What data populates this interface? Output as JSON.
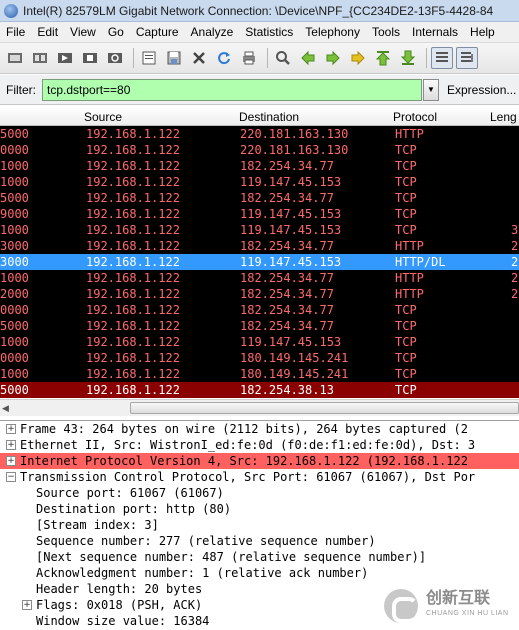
{
  "window": {
    "title": "Intel(R) 82579LM Gigabit Network Connection: \\Device\\NPF_{CC234DE2-13F5-4428-84"
  },
  "menu": [
    "File",
    "Edit",
    "View",
    "Go",
    "Capture",
    "Analyze",
    "Statistics",
    "Telephony",
    "Tools",
    "Internals",
    "Help"
  ],
  "toolbar": {
    "icons": [
      "interface-list-icon",
      "capture-options-icon",
      "start-capture-icon",
      "stop-capture-icon",
      "restart-capture-icon",
      "open-file-icon",
      "save-file-icon",
      "close-file-icon",
      "reload-icon",
      "print-icon",
      "find-packet-icon",
      "go-back-icon",
      "go-forward-icon",
      "go-to-packet-icon",
      "go-first-icon",
      "go-last-icon",
      "colorize-icon",
      "auto-scroll-icon"
    ]
  },
  "filter": {
    "label": "Filter:",
    "value": "tcp.dstport==80",
    "expression_label": "Expression..."
  },
  "columns": {
    "source": "Source",
    "destination": "Destination",
    "protocol": "Protocol",
    "length": "Leng"
  },
  "packets": [
    {
      "time": "5000",
      "source": "192.168.1.122",
      "destination": "220.181.163.130",
      "protocol": "HTTP",
      "length": ""
    },
    {
      "time": "0000",
      "source": "192.168.1.122",
      "destination": "220.181.163.130",
      "protocol": "TCP",
      "length": ""
    },
    {
      "time": "1000",
      "source": "192.168.1.122",
      "destination": "182.254.34.77",
      "protocol": "TCP",
      "length": ""
    },
    {
      "time": "1000",
      "source": "192.168.1.122",
      "destination": "119.147.45.153",
      "protocol": "TCP",
      "length": ""
    },
    {
      "time": "5000",
      "source": "192.168.1.122",
      "destination": "182.254.34.77",
      "protocol": "TCP",
      "length": ""
    },
    {
      "time": "9000",
      "source": "192.168.1.122",
      "destination": "119.147.45.153",
      "protocol": "TCP",
      "length": ""
    },
    {
      "time": "1000",
      "source": "192.168.1.122",
      "destination": "119.147.45.153",
      "protocol": "TCP",
      "length": "3"
    },
    {
      "time": "3000",
      "source": "192.168.1.122",
      "destination": "182.254.34.77",
      "protocol": "HTTP",
      "length": "2"
    },
    {
      "time": "3000",
      "source": "192.168.1.122",
      "destination": "119.147.45.153",
      "protocol": "HTTP/DL",
      "length": "2"
    },
    {
      "time": "1000",
      "source": "192.168.1.122",
      "destination": "182.254.34.77",
      "protocol": "HTTP",
      "length": "2"
    },
    {
      "time": "2000",
      "source": "192.168.1.122",
      "destination": "182.254.34.77",
      "protocol": "HTTP",
      "length": "2"
    },
    {
      "time": "0000",
      "source": "192.168.1.122",
      "destination": "182.254.34.77",
      "protocol": "TCP",
      "length": ""
    },
    {
      "time": "5000",
      "source": "192.168.1.122",
      "destination": "182.254.34.77",
      "protocol": "TCP",
      "length": ""
    },
    {
      "time": "1000",
      "source": "192.168.1.122",
      "destination": "119.147.45.153",
      "protocol": "TCP",
      "length": ""
    },
    {
      "time": "0000",
      "source": "192.168.1.122",
      "destination": "180.149.145.241",
      "protocol": "TCP",
      "length": ""
    },
    {
      "time": "1000",
      "source": "192.168.1.122",
      "destination": "180.149.145.241",
      "protocol": "TCP",
      "length": ""
    },
    {
      "time": "5000",
      "source": "192.168.1.122",
      "destination": "182.254.38.13",
      "protocol": "TCP",
      "length": ""
    }
  ],
  "details": [
    {
      "text": "Frame 43: 264 bytes on wire (2112 bits), 264 bytes captured (2",
      "expander": "+",
      "indent": 0
    },
    {
      "text": "Ethernet II, Src: WistronI_ed:fe:0d (f0:de:f1:ed:fe:0d), Dst: 3",
      "expander": "+",
      "indent": 0
    },
    {
      "text": "Internet Protocol Version 4, Src: 192.168.1.122 (192.168.1.122",
      "expander": "+",
      "indent": 0
    },
    {
      "text": "Transmission Control Protocol, Src Port: 61067 (61067), Dst Por",
      "expander": "−",
      "indent": 0
    },
    {
      "text": "Source port: 61067 (61067)",
      "expander": "",
      "indent": 1
    },
    {
      "text": "Destination port: http (80)",
      "expander": "",
      "indent": 1
    },
    {
      "text": "[Stream index: 3]",
      "expander": "",
      "indent": 1
    },
    {
      "text": "Sequence number: 277    (relative sequence number)",
      "expander": "",
      "indent": 1
    },
    {
      "text": "[Next sequence number: 487    (relative sequence number)]",
      "expander": "",
      "indent": 1
    },
    {
      "text": "Acknowledgment number: 1    (relative ack number)",
      "expander": "",
      "indent": 1
    },
    {
      "text": "Header length: 20 bytes",
      "expander": "",
      "indent": 1
    },
    {
      "text": "Flags: 0x018 (PSH, ACK)",
      "expander": "+",
      "indent": 1
    },
    {
      "text": "Window size value: 16384",
      "expander": "",
      "indent": 1
    }
  ],
  "watermark": {
    "big": "创新互联",
    "small": "CHUANG XIN HU LIAN"
  },
  "colors": {
    "packet_text": "#ff6b6b",
    "selected_row": "#3399ff",
    "last_row": "#8b0000",
    "ip_highlight": "#ff6060",
    "filter_valid": "#afffaf"
  }
}
